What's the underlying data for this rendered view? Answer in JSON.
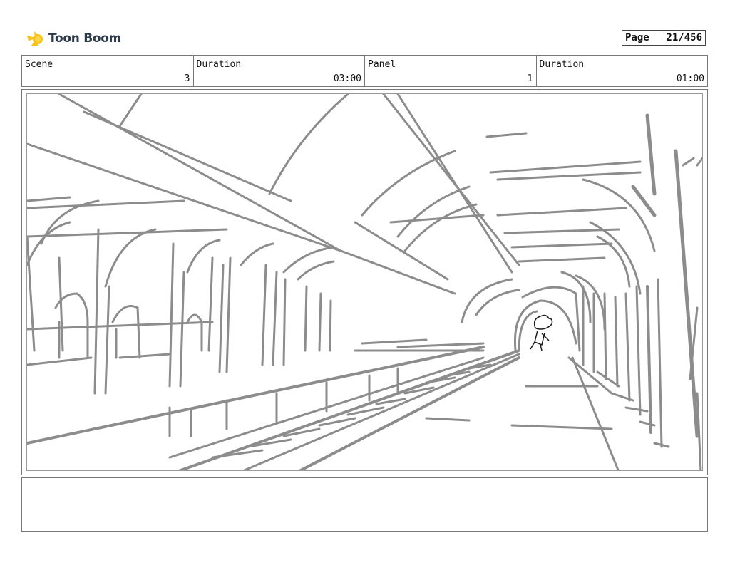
{
  "logo": {
    "name": "Toon Boom",
    "icon": "toon-boom-logo-icon",
    "brand_color": "#f6c21c"
  },
  "page": {
    "label": "Page",
    "value": "21/456"
  },
  "header": {
    "cells": [
      {
        "label": "Scene",
        "value": "3"
      },
      {
        "label": "Duration",
        "value": "03:00"
      },
      {
        "label": "Panel",
        "value": "1"
      },
      {
        "label": "Duration",
        "value": "01:00"
      }
    ]
  },
  "panel": {
    "sketch_stroke_color": "#8c8c8c",
    "character_ink_color": "#1a1a1a"
  },
  "notes": {
    "text": ""
  }
}
